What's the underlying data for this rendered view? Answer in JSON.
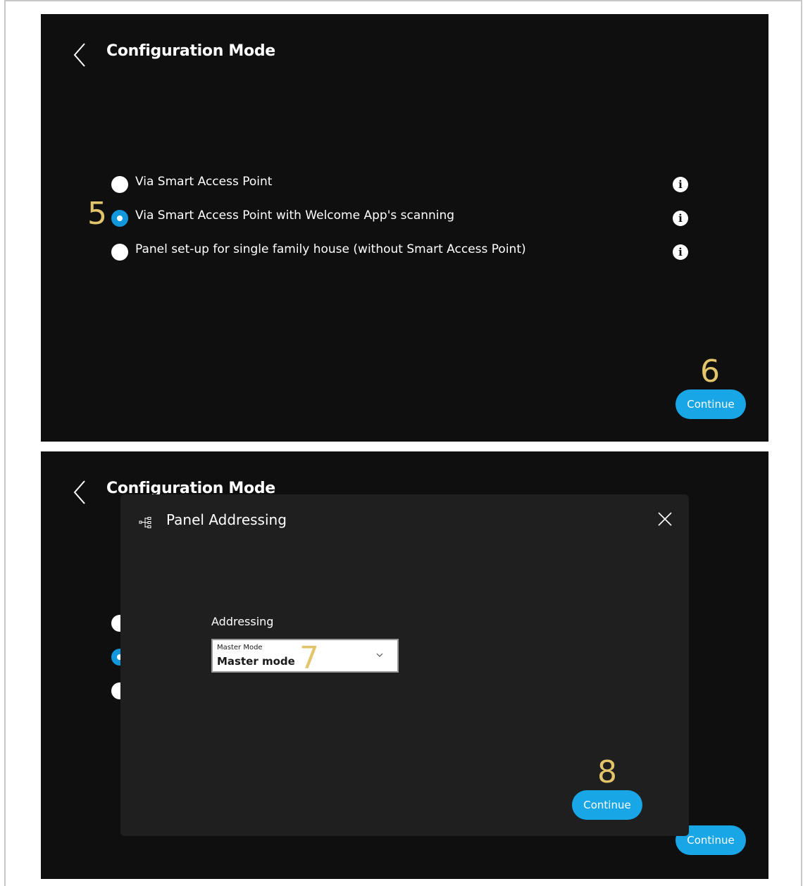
{
  "screen1": {
    "title": "Configuration Mode",
    "options": [
      {
        "label": "Via Smart Access Point",
        "selected": false
      },
      {
        "label": "Via Smart Access Point with Welcome App's scanning",
        "selected": true
      },
      {
        "label": "Panel set-up for single family house (without Smart Access Point)",
        "selected": false
      }
    ],
    "info_icon": "i",
    "continue_label": "Continue"
  },
  "screen2": {
    "title": "Configuration Mode",
    "continue_label": "Continue",
    "dialog": {
      "title": "Panel Addressing",
      "field_label": "Addressing",
      "select_caption": "Master Mode",
      "select_value": "Master mode",
      "continue_label": "Continue"
    }
  },
  "annotations": {
    "step5": "5",
    "step6": "6",
    "step7": "7",
    "step8": "8"
  },
  "colors": {
    "screen_bg": "#0f0f10",
    "dialog_bg": "#1f1f20",
    "accent": "#18a6e6",
    "annotation": "#e2c56b"
  },
  "icons": [
    "chevron-left-icon",
    "info-icon",
    "panel-addressing-icon",
    "close-icon",
    "chevron-down-icon"
  ]
}
